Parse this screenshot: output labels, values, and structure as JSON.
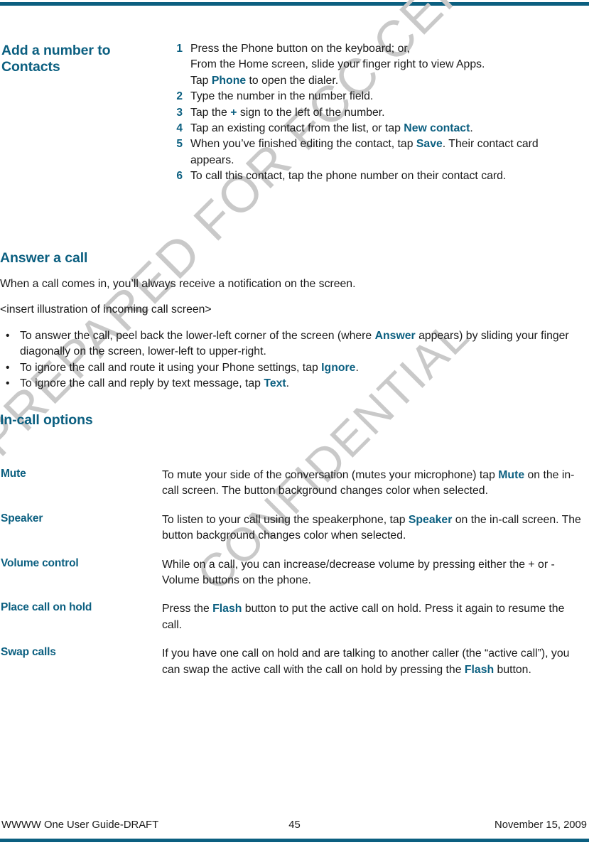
{
  "page": {
    "accent_color": "#0b5f80",
    "text_color": "#1a1a1a",
    "watermark_color": "#c9c9c9"
  },
  "watermark": {
    "line1": "PREPARED FOR FCC CERTIFICATION",
    "line2": "CONFIDENTIAL"
  },
  "procedure": {
    "heading": "Add a number to Contacts",
    "steps": [
      {
        "num": "1",
        "parts": [
          {
            "t": "Press the Phone button on the keyboard; or,"
          },
          {
            "br": true
          },
          {
            "t": "From the Home screen, slide your finger right to view Apps."
          },
          {
            "br": true
          },
          {
            "t": "Tap "
          },
          {
            "t": "Phone",
            "kw": true
          },
          {
            "t": " to open the dialer."
          }
        ]
      },
      {
        "num": "2",
        "parts": [
          {
            "t": "Type the number in the number field."
          }
        ]
      },
      {
        "num": "3",
        "parts": [
          {
            "t": "Tap the "
          },
          {
            "t": "+",
            "kw": true
          },
          {
            "t": " sign to the left of the number."
          }
        ]
      },
      {
        "num": "4",
        "parts": [
          {
            "t": "Tap an existing contact from the list, or tap "
          },
          {
            "t": "New contact",
            "kw": true
          },
          {
            "t": "."
          }
        ]
      },
      {
        "num": "5",
        "parts": [
          {
            "t": "When you’ve finished editing the contact, tap "
          },
          {
            "t": "Save",
            "kw": true
          },
          {
            "t": ". Their contact card appears."
          }
        ]
      },
      {
        "num": "6",
        "parts": [
          {
            "t": "To call this contact, tap the phone number on their contact card."
          }
        ]
      }
    ]
  },
  "answer_section": {
    "heading": "Answer a call",
    "intro": "When a call comes in, you’ll always receive a notification on the screen.",
    "placeholder_note": "<insert illustration of incoming call screen>",
    "bullets": [
      {
        "bullet_glyph": "•",
        "parts": [
          {
            "t": "To answer the call, peel back the lower-left corner of the screen (where "
          },
          {
            "t": "Answer",
            "kw": true
          },
          {
            "t": " appears) by sliding your finger diagonally on the screen, lower-left to upper-right."
          }
        ]
      },
      {
        "bullet_glyph": "•",
        "parts": [
          {
            "t": "To ignore the call and route it using your Phone settings, tap "
          },
          {
            "t": "Ignore",
            "kw": true
          },
          {
            "t": "."
          }
        ]
      },
      {
        "bullet_glyph": "•",
        "parts": [
          {
            "t": "To ignore the call and reply by text message, tap "
          },
          {
            "t": "Text",
            "kw": true
          },
          {
            "t": "."
          }
        ]
      }
    ]
  },
  "incall_section": {
    "heading": "In-call options",
    "rows": [
      {
        "term": "Mute",
        "parts": [
          {
            "t": "To mute your side of the conversation (mutes your microphone) tap "
          },
          {
            "t": "Mute",
            "kw": true
          },
          {
            "t": " on the in-call screen. The button background changes color when selected."
          }
        ]
      },
      {
        "term": "Speaker",
        "parts": [
          {
            "t": "To listen to your call using the speakerphone, tap "
          },
          {
            "t": "Speaker",
            "kw": true
          },
          {
            "t": " on the in-call screen. The button background changes color when selected."
          }
        ]
      },
      {
        "term": "Volume control",
        "parts": [
          {
            "t": "While on a call, you can increase/decrease volume by pressing either the + or - Volume buttons on the phone."
          }
        ]
      },
      {
        "term": "Place call on hold",
        "parts": [
          {
            "t": "Press the "
          },
          {
            "t": "Flash",
            "kw": true
          },
          {
            "t": " button to put the active call on hold. Press it again to resume the call."
          }
        ]
      },
      {
        "term": "Swap calls",
        "parts": [
          {
            "t": "If you have one call on hold and are talking to another caller (the “active call”), you can swap the active call with the call on hold by pressing the "
          },
          {
            "t": "Flash",
            "kw": true
          },
          {
            "t": " button."
          }
        ]
      }
    ]
  },
  "footer": {
    "left": "WWWW One User Guide-DRAFT",
    "page_number": "45",
    "right": "November 15, 2009"
  }
}
